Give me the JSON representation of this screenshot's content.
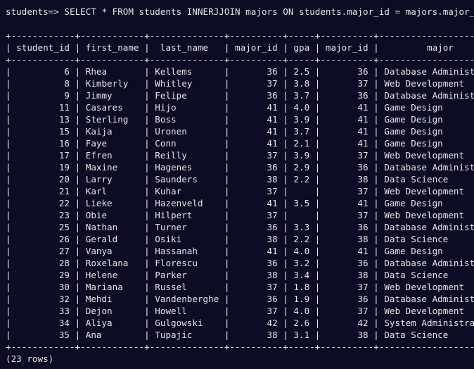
{
  "prompt": "students=> SELECT * FROM students INNERJJOIN majors ON students.major_id = majors.major_id;",
  "separator": "+------------+------------+--------------+----------+-----+----------+------------------------+",
  "separator_mid": "+------------+------------+--------------+----------+-----+----------+------------------------+",
  "header": "| student_id | first_name |  last_name   | major_id | gpa | major_id |         major          |",
  "rows": [
    "|          6 | Rhea       | Kellems      |       36 | 2.5 |       36 | Database Administration|",
    "|          8 | Kimberly   | Whitley      |       37 | 3.8 |       37 | Web Development        |",
    "|          9 | Jimmy      | Felipe       |       36 | 3.7 |       36 | Database Administration|",
    "|         11 | Casares    | Hijo         |       41 | 4.0 |       41 | Game Design            |",
    "|         13 | Sterling   | Boss         |       41 | 3.9 |       41 | Game Design            |",
    "|         15 | Kaija      | Uronen       |       41 | 3.7 |       41 | Game Design            |",
    "|         16 | Faye       | Conn         |       41 | 2.1 |       41 | Game Design            |",
    "|         17 | Efren      | Reilly       |       37 | 3.9 |       37 | Web Development        |",
    "|         19 | Maxine     | Hagenes      |       36 | 2.9 |       36 | Database Administration|",
    "|         20 | Larry      | Saunders     |       38 | 2.2 |       38 | Data Science           |",
    "|         21 | Karl       | Kuhar        |       37 |     |       37 | Web Development        |",
    "|         22 | Lieke      | Hazenveld    |       41 | 3.5 |       41 | Game Design            |",
    "|         23 | Obie       | Hilpert      |       37 |     |       37 | Web Development        |",
    "|         25 | Nathan     | Turner       |       36 | 3.3 |       36 | Database Administration|",
    "|         26 | Gerald     | Osiki        |       38 | 2.2 |       38 | Data Science           |",
    "|         27 | Vanya      | Hassanah     |       41 | 4.0 |       41 | Game Design            |",
    "|         28 | Roxelana   | Florescu     |       36 | 3.2 |       36 | Database Administration|",
    "|         29 | Helene     | Parker       |       38 | 3.4 |       38 | Data Science           |",
    "|         30 | Mariana    | Russel       |       37 | 1.8 |       37 | Web Development        |",
    "|         32 | Mehdi      | Vandenberghe |       36 | 1.9 |       36 | Database Administration|",
    "|         33 | Dejon      | Howell       |       37 | 4.0 |       37 | Web Development        |",
    "|         34 | Aliya      | Gulgowski    |       42 | 2.6 |       42 | System Administration  |",
    "|         35 | Ana        | Tupajic      |       38 | 3.1 |       38 | Data Science           |"
  ],
  "footer": "(23 rows)",
  "colors": {
    "background": "#0c0c24",
    "text": "#e6e6e6"
  }
}
